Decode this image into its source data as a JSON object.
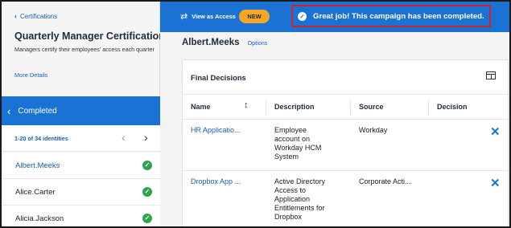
{
  "sidebar": {
    "back_link": "Certifications",
    "campaign_title": "Quarterly Manager Certification",
    "campaign_description": "Managers certify their employees' access each quarter",
    "more_details": "More Details",
    "status_filter": "Completed",
    "pager_count": "1-20 of 34 identities",
    "identities": [
      {
        "name": "Albert.Meeks",
        "active": true,
        "status": "completed"
      },
      {
        "name": "Alice.Carter",
        "active": false,
        "status": "completed"
      },
      {
        "name": "Alicia.Jackson",
        "active": false,
        "status": "completed"
      }
    ]
  },
  "topbar": {
    "view_as_label": "View as Access",
    "new_badge": "NEW",
    "banner_text": "Great job! This campaign has been completed."
  },
  "main": {
    "user_name": "Albert.Meeks",
    "options_link": "Options",
    "section_title": "Final Decisions",
    "columns": [
      "Name",
      "Description",
      "Source",
      "Decision"
    ],
    "rows": [
      {
        "name": "HR Applicatio...",
        "description": [
          "Employee",
          "account on",
          "Workday HCM",
          "System"
        ],
        "source": "Workday",
        "decision": "revoke"
      },
      {
        "name": "Dropbox App ...",
        "description": [
          "Active Directory",
          "Access to",
          "Application",
          "Entitlements for",
          "Dropbox"
        ],
        "source": "Corporate Acti...",
        "decision": "revoke"
      }
    ]
  },
  "icons": {
    "back": "chevron-left-icon",
    "swap": "swap-arrows-icon",
    "banner": "check-badge-icon",
    "sort": "sort-vertical-icon",
    "layout": "column-layout-icon",
    "decision": "close-x-icon",
    "status": "check-circle-icon"
  },
  "colors": {
    "accent": "#1a73d4",
    "badge": "#f6a623",
    "banner_border": "#d0222a",
    "success": "#2ea44f",
    "link": "#1b5fb4"
  }
}
